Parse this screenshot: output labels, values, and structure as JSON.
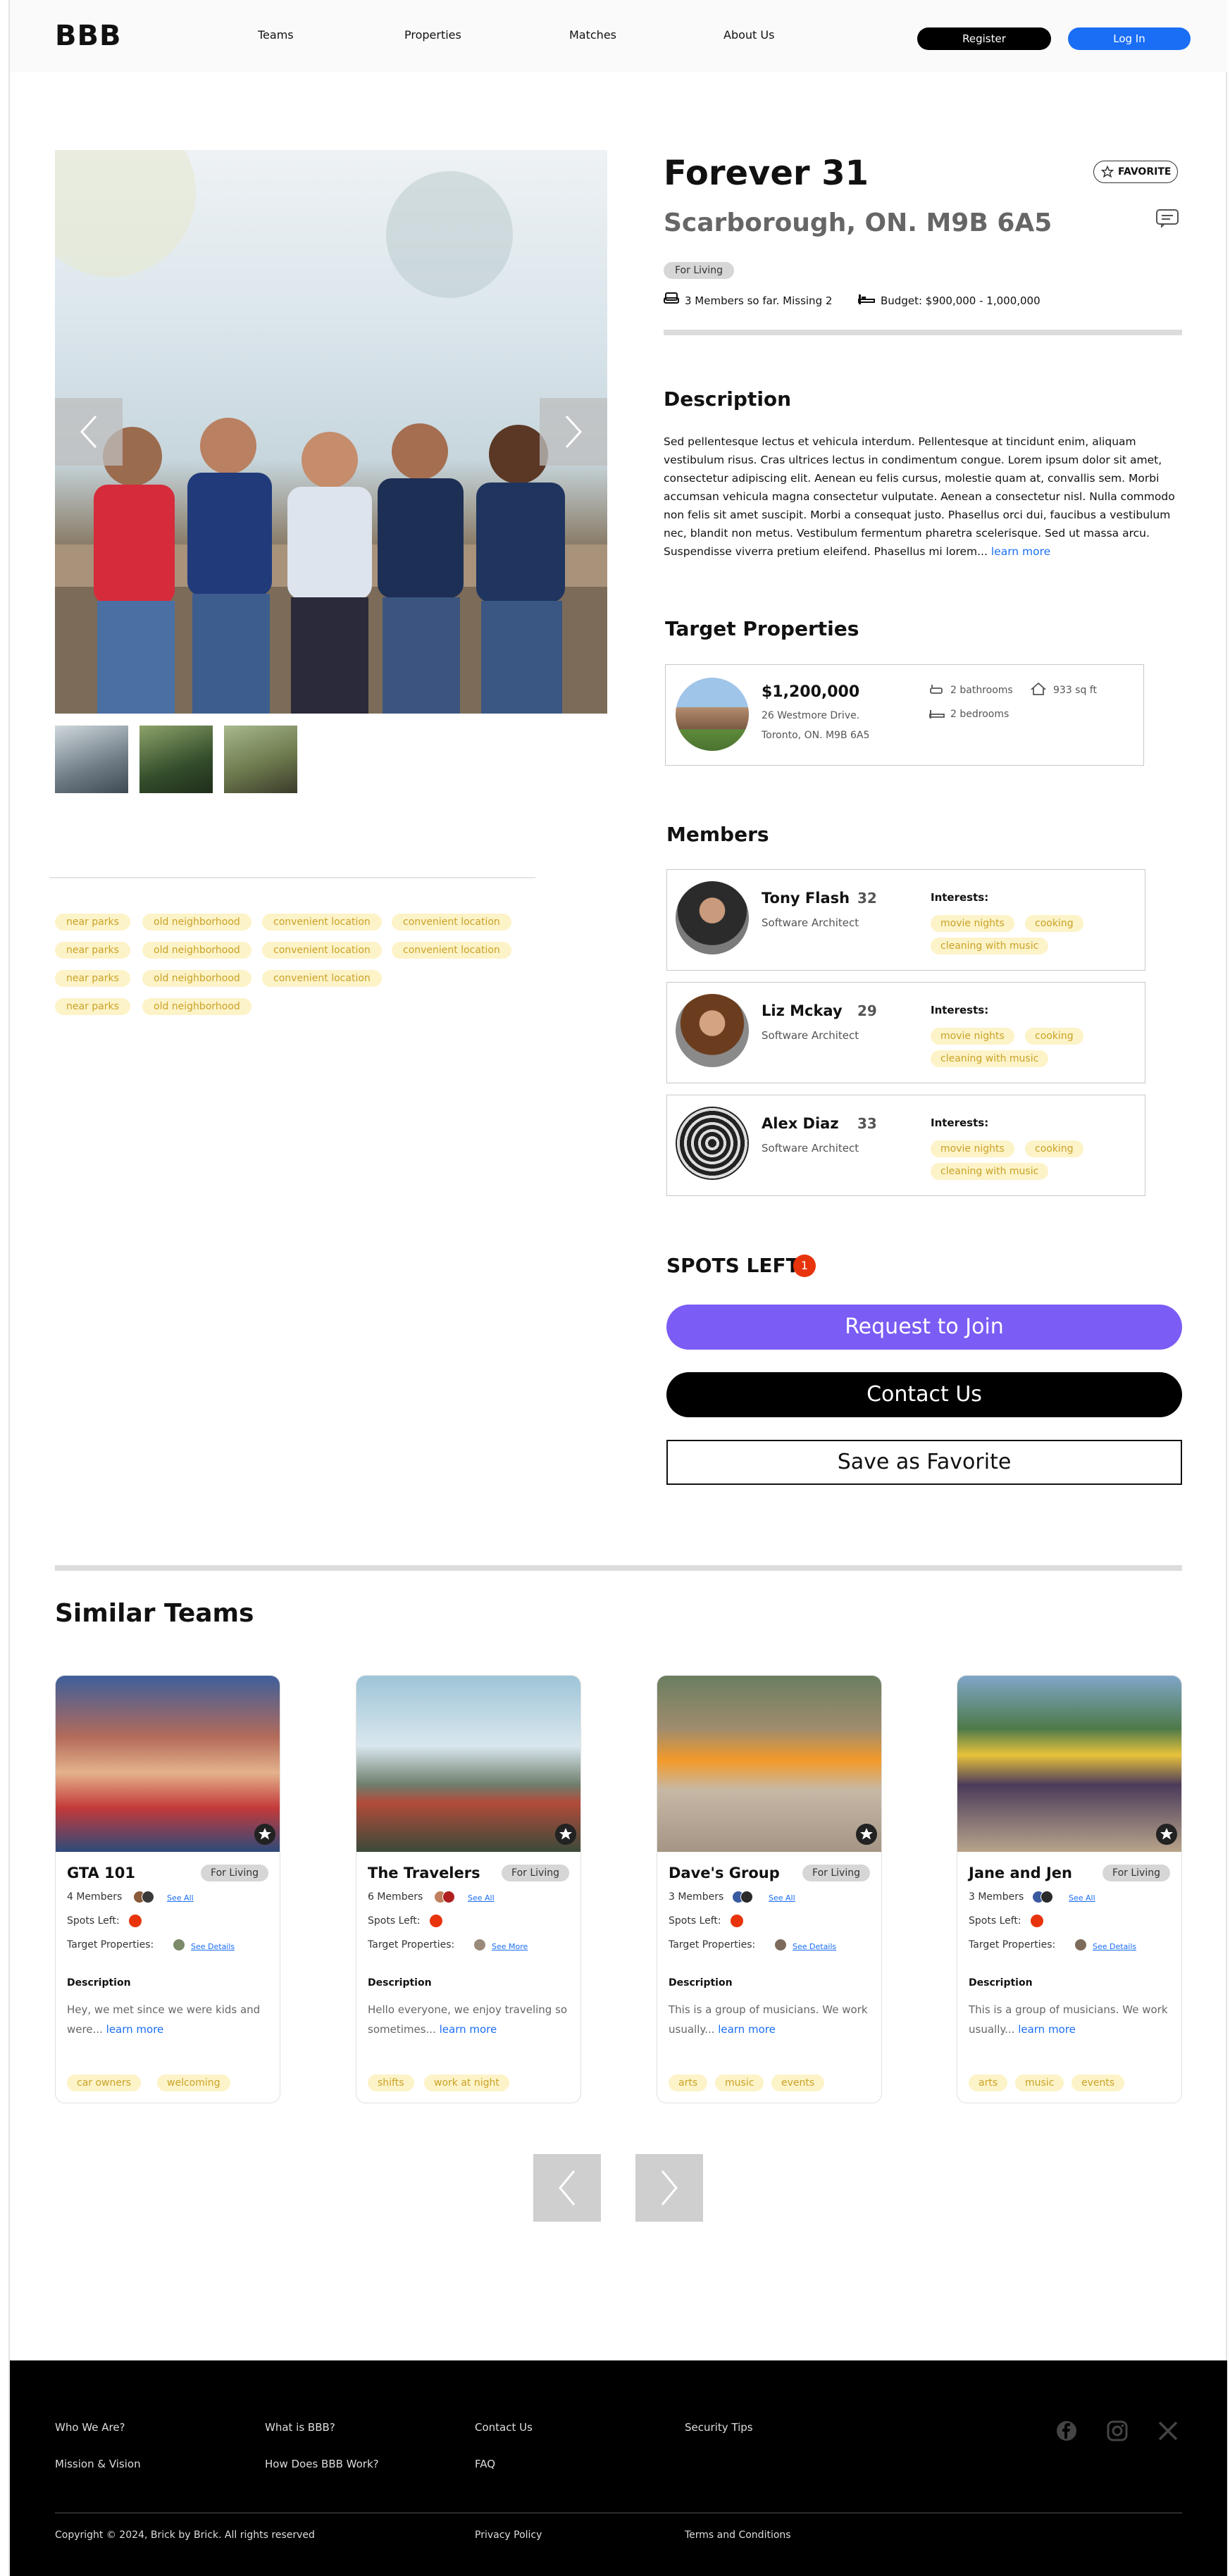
{
  "header": {
    "logo": "BBB",
    "nav": [
      "Teams",
      "Properties",
      "Matches",
      "About Us"
    ],
    "register": "Register",
    "login": "Log In"
  },
  "listing": {
    "title": "Forever 31",
    "favorite_chip": "FAVORITE",
    "subtitle": "Scarborough, ON. M9B 6A5",
    "type_badge": "For Living",
    "members_info": "3 Members so far. Missing 2",
    "budget": "Budget: $900,000 - 1,000,000",
    "description_heading": "Description",
    "description": "Sed pellentesque lectus et vehicula interdum. Pellentesque at tincidunt enim, aliquam vestibulum risus. Cras ultrices lectus in condimentum congue. Lorem ipsum dolor sit amet, consectetur adipiscing elit. Aenean eu felis cursus, molestie quam at, convallis sem. Morbi accumsan vehicula magna consectetur vulputate. Aenean a consectetur nisl. Nulla commodo non felis sit amet suscipit. Morbi a consequat justo. Phasellus orci dui, faucibus a vestibulum nec, blandit non metus. Vestibulum fermentum pharetra scelerisque. Sed ut massa arcu. Suspendisse viverra pretium eleifend. Phasellus mi lorem...",
    "learn_more": "learn more"
  },
  "tags": [
    [
      "near parks",
      "old neighborhood",
      "convenient location",
      "convenient location"
    ],
    [
      "near parks",
      "old neighborhood",
      "convenient location",
      "convenient location"
    ],
    [
      "near parks",
      "old neighborhood",
      "convenient location"
    ],
    [
      "near parks",
      "old neighborhood"
    ]
  ],
  "target_properties": {
    "heading": "Target Properties",
    "price": "$1,200,000",
    "address_line1": "26 Westmore Drive.",
    "address_line2": "Toronto, ON. M9B 6A5",
    "bathrooms": "2 bathrooms",
    "area": "933 sq ft",
    "bedrooms": "2 bedrooms"
  },
  "members": {
    "heading": "Members",
    "interests_label": "Interests:",
    "list": [
      {
        "name": "Tony Flash",
        "age": "32",
        "role": "Software Architect",
        "interests": [
          "movie nights",
          "cooking",
          "cleaning with music"
        ]
      },
      {
        "name": "Liz Mckay",
        "age": "29",
        "role": "Software Architect",
        "interests": [
          "movie nights",
          "cooking",
          "cleaning with music"
        ]
      },
      {
        "name": "Alex Diaz",
        "age": "33",
        "role": "Software Architect",
        "interests": [
          "movie nights",
          "cooking",
          "cleaning with music"
        ]
      }
    ]
  },
  "actions": {
    "spots_left_label": "SPOTS LEFT",
    "spots_left_count": "1",
    "request": "Request to Join",
    "contact": "Contact Us",
    "save": "Save as Favorite"
  },
  "similar": {
    "heading": "Similar Teams",
    "spots_label": "Spots Left:",
    "target_label": "Target Properties:",
    "desc_label": "Description",
    "see_all": "See All",
    "teams": [
      {
        "name": "GTA 101",
        "type": "For Living",
        "members": "4 Members",
        "target_link": "See Details",
        "description": "Hey, we met since we were kids and were...",
        "learn": "learn more",
        "tags": [
          "car owners",
          "welcoming"
        ]
      },
      {
        "name": "The Travelers",
        "type": "For Living",
        "members": "6 Members",
        "target_link": "See More",
        "description": "Hello everyone, we enjoy traveling so sometimes...",
        "learn": "learn more",
        "tags": [
          "shifts",
          "work at night"
        ]
      },
      {
        "name": "Dave's Group",
        "type": "For Living",
        "members": "3 Members",
        "target_link": "See Details",
        "description": "This is a group of musicians. We work usually...",
        "learn": "learn more",
        "tags": [
          "arts",
          "music",
          "events"
        ]
      },
      {
        "name": "Jane and Jen",
        "type": "For Living",
        "members": "3 Members",
        "target_link": "See Details",
        "description": "This is a group of musicians. We work usually...",
        "learn": "learn more",
        "tags": [
          "arts",
          "music",
          "events"
        ]
      }
    ]
  },
  "footer": {
    "links": [
      "Who We Are?",
      "What is BBB?",
      "Contact Us",
      "Security Tips",
      "Mission & Vision",
      "How Does BBB Work?",
      "FAQ"
    ],
    "copyright": "Copyright © 2024, Brick by Brick. All rights reserved",
    "privacy": "Privacy Policy",
    "terms": "Terms and Conditions"
  }
}
